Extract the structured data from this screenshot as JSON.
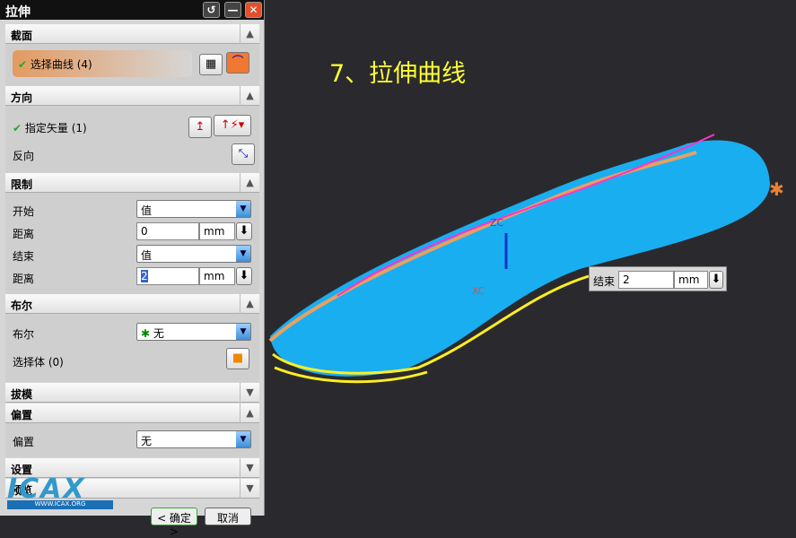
{
  "dialog": {
    "title": "拉伸",
    "buttons": {
      "reset": "↺",
      "minimize": "—",
      "close": "✕"
    }
  },
  "sections": {
    "section": {
      "title": "截面",
      "select_curve": "选择曲线 (4)"
    },
    "direction": {
      "title": "方向",
      "specify_vector": "指定矢量 (1)",
      "reverse": "反向"
    },
    "limits": {
      "title": "限制",
      "start_label": "开始",
      "start_value": "值",
      "distance1_label": "距离",
      "distance1_value": "0",
      "unit": "mm",
      "end_label": "结束",
      "end_value": "值",
      "distance2_label": "距离",
      "distance2_value": "2"
    },
    "boolean": {
      "title": "布尔",
      "boolean_label": "布尔",
      "boolean_value": "无",
      "select_body": "选择体 (0)"
    },
    "draft": {
      "title": "拔模"
    },
    "offset": {
      "title": "偏置",
      "offset_label": "偏置",
      "offset_value": "无"
    },
    "settings": {
      "title": "设置"
    },
    "preview": {
      "title": "预览"
    }
  },
  "footer": {
    "ok": "< 确定 >",
    "cancel": "取消"
  },
  "logo": {
    "text": "ICAX",
    "url": "WWW.ICAX.ORG"
  },
  "viewport": {
    "caption": "7、拉伸曲线",
    "axis_z": "ZC",
    "axis_x": "XC",
    "popup_label": "结束",
    "popup_value": "2",
    "popup_unit": "mm"
  }
}
